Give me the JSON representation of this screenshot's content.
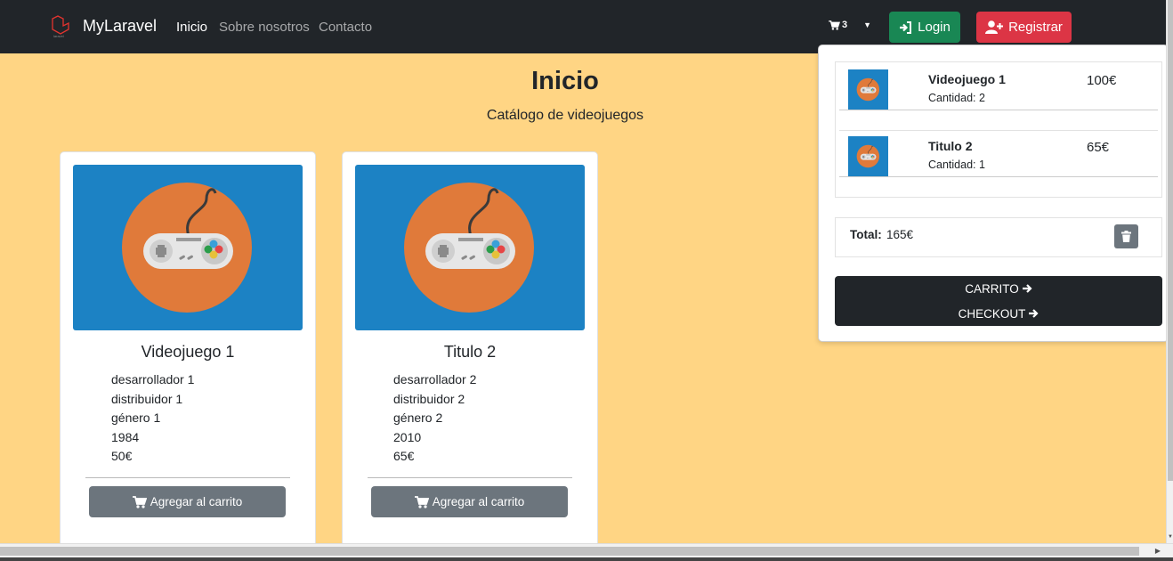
{
  "nav": {
    "brand": "MyLaravel",
    "links": [
      "Inicio",
      "Sobre nosotros",
      "Contacto"
    ],
    "cart_count": "3",
    "login": "Login",
    "register": "Registrar"
  },
  "header": {
    "title": "Inicio",
    "subtitle": "Catálogo de videojuegos"
  },
  "products": [
    {
      "title": "Videojuego 1",
      "developer": "desarrollador 1",
      "distributor": "distribuidor 1",
      "genre": "género 1",
      "year": "1984",
      "price": "50€",
      "add_label": "Agregar al carrito"
    },
    {
      "title": "Titulo 2",
      "developer": "desarrollador 2",
      "distributor": "distribuidor 2",
      "genre": "género 2",
      "year": "2010",
      "price": "65€",
      "add_label": "Agregar al carrito"
    }
  ],
  "cart": {
    "items": [
      {
        "name": "Videojuego 1",
        "quantity": "Cantidad: 2",
        "price": "100€"
      },
      {
        "name": "Titulo 2",
        "quantity": "Cantidad: 1",
        "price": "65€"
      }
    ],
    "total_label": "Total:",
    "total_value": "165€",
    "carrito_label": "CARRITO",
    "checkout_label": "CHECKOUT"
  },
  "icons": {
    "brand": "laravel-logo-icon",
    "cart": "cart-icon",
    "login": "sign-in-icon",
    "register": "user-plus-icon",
    "trash": "trash-icon",
    "arrow": "arrow-right-icon",
    "product_image": "gamepad-icon"
  },
  "colors": {
    "page_bg": "#ffd584",
    "navbar": "#212529",
    "login": "#198754",
    "register": "#dc3545",
    "secondary": "#6c757d",
    "image_bg": "#1c82c4",
    "image_circle": "#e07a3a"
  }
}
